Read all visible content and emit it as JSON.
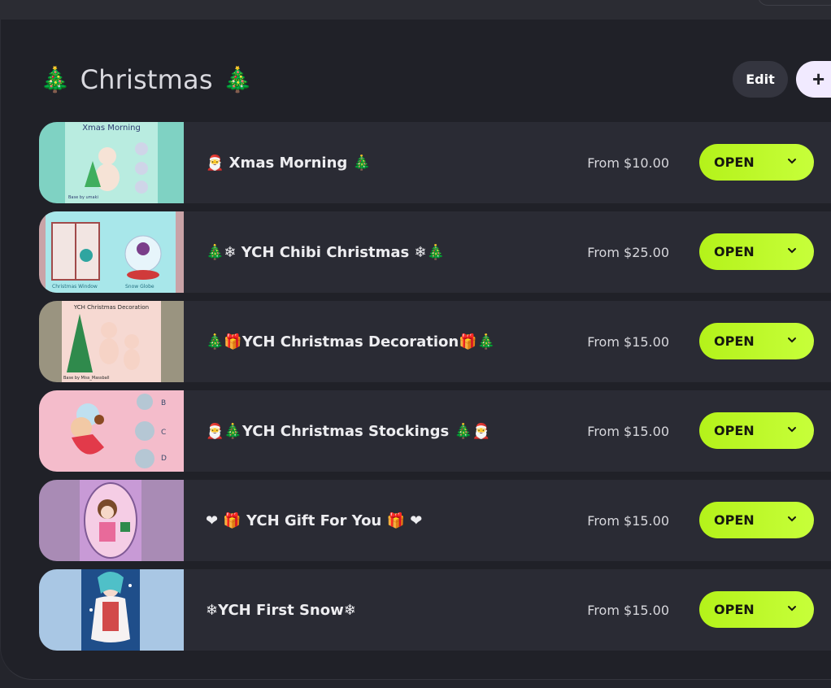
{
  "section": {
    "title": "Christmas",
    "title_left_emoji": "🎄",
    "title_right_emoji": "🎄"
  },
  "toolbar": {
    "edit_label": "Edit",
    "add_label": "+"
  },
  "items": [
    {
      "title": "🎅 Xmas Morning 🎄",
      "price": "From $10.00",
      "button": "OPEN",
      "thumb_bg": "#7fd2c3",
      "thumb_caption": "Xmas Morning",
      "thumb_footer": "Base by umaki"
    },
    {
      "title": "🎄❄ YCH Chibi Christmas ❄🎄",
      "price": "From $25.00",
      "button": "OPEN",
      "thumb_bg": "#a8e7ea",
      "thumb_caption_left": "Christmas Window",
      "thumb_caption_right": "Snow Globe"
    },
    {
      "title": "🎄🎁YCH Christmas Decoration🎁🎄",
      "price": "From $15.00",
      "button": "OPEN",
      "thumb_bg": "#f6d9d2",
      "thumb_caption": "YCH Christmas Decoration",
      "thumb_footer": "Base by Miss_Massball"
    },
    {
      "title": "🎅🎄YCH Christmas Stockings 🎄🎅",
      "price": "From $15.00",
      "button": "OPEN",
      "thumb_bg": "#f4bccb",
      "thumb_labels": [
        "B",
        "C",
        "D"
      ]
    },
    {
      "title": "❤ 🎁 YCH Gift For You 🎁 ❤",
      "price": "From $15.00",
      "button": "OPEN",
      "thumb_bg": "#c89ad6"
    },
    {
      "title": "❄YCH First Snow❄",
      "price": "From $15.00",
      "button": "OPEN",
      "thumb_bg": "#a9c7e4"
    }
  ],
  "colors": {
    "accent_lime": "#b4f21a",
    "panel_bg": "#202128",
    "row_bg": "#2a2b34"
  }
}
